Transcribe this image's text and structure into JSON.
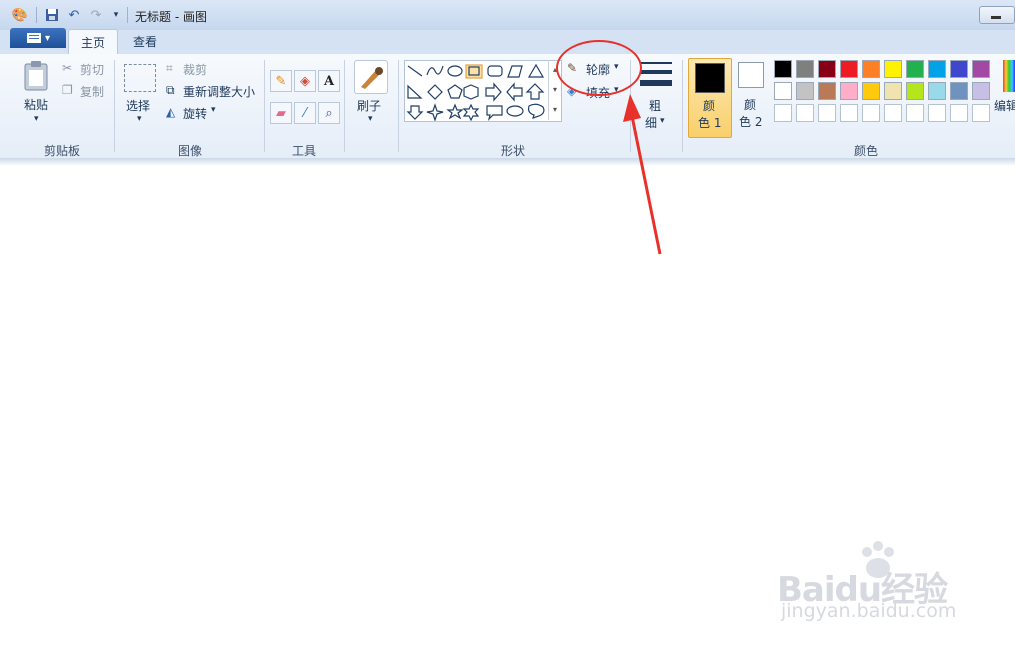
{
  "window": {
    "title": "无标题 - 画图"
  },
  "tabs": [
    {
      "label": "主页"
    },
    {
      "label": "查看"
    }
  ],
  "clipboard": {
    "paste": "粘贴",
    "cut": "剪切",
    "copy": "复制",
    "group": "剪贴板"
  },
  "image": {
    "select": "选择",
    "crop": "裁剪",
    "resize": "重新调整大小",
    "rotate": "旋转",
    "group": "图像"
  },
  "tools": {
    "group": "工具",
    "text_glyph": "A"
  },
  "brushes": {
    "label": "刷子"
  },
  "shapes": {
    "outline": "轮廓",
    "fill": "填充",
    "group": "形状"
  },
  "size": {
    "label_top": "粗",
    "label_bottom": "细"
  },
  "colors": {
    "color1_top": "颜",
    "color1_bottom": "色 1",
    "color2_top": "颜",
    "color2_bottom": "色 2",
    "edit": "编辑",
    "group": "颜色",
    "palette_row1": [
      "#000000",
      "#7f7f7f",
      "#880015",
      "#ed1c24",
      "#ff7f27",
      "#fff200",
      "#22b14c",
      "#00a2e8",
      "#3f48cc",
      "#a349a4"
    ],
    "palette_row2": [
      "#ffffff",
      "#c3c3c3",
      "#b97a57",
      "#ffaec9",
      "#ffc90e",
      "#efe4b0",
      "#b5e61d",
      "#99d9ea",
      "#7092be",
      "#c8bfe7"
    ]
  },
  "annotation_color": "#e8312a",
  "watermark": {
    "brand": "Baidu经验",
    "url": "jingyan.baidu.com"
  }
}
